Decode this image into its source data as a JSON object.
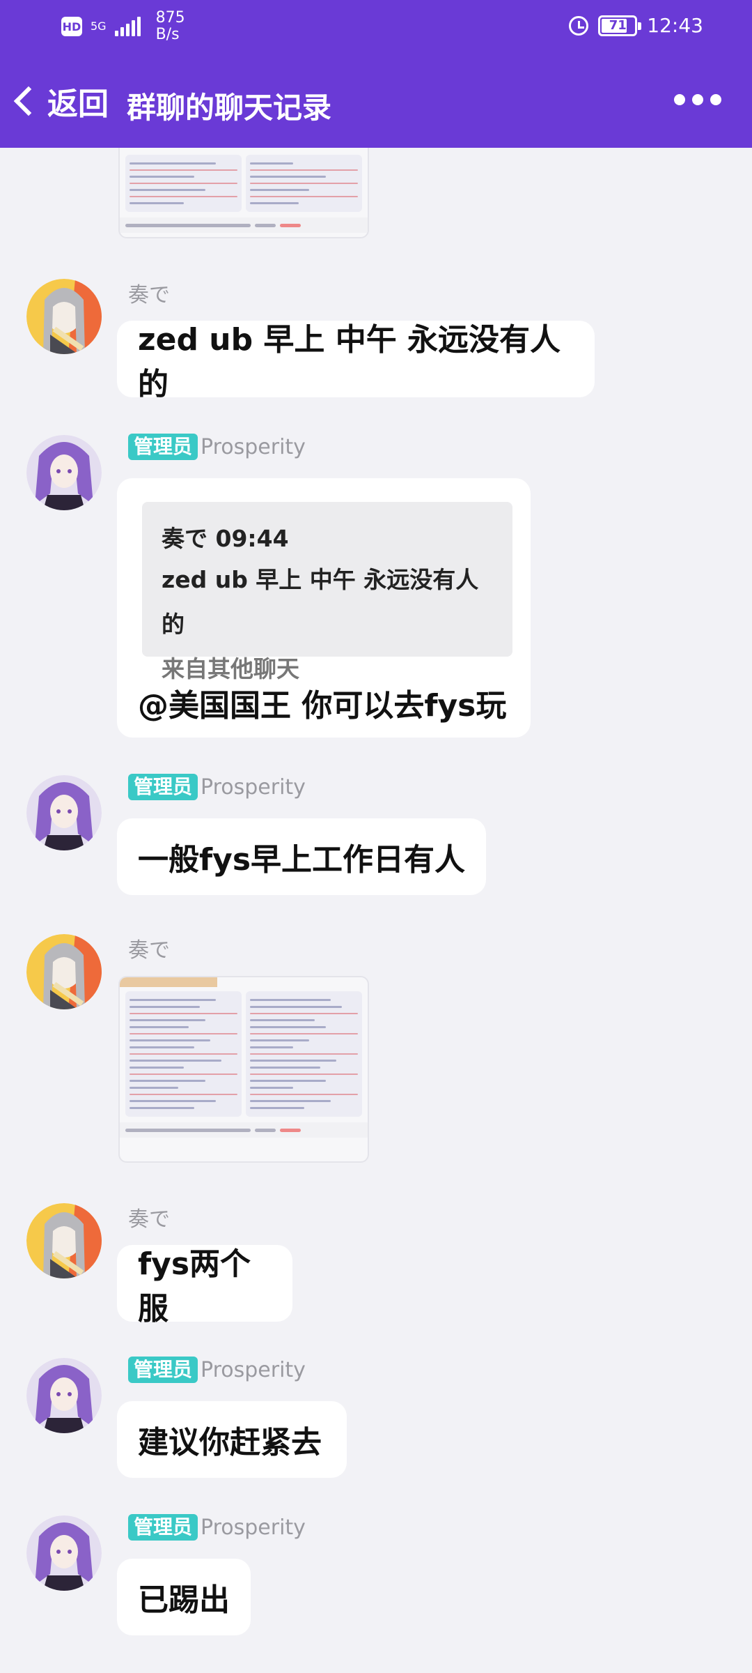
{
  "status_bar": {
    "network": "5G",
    "hd": "HD",
    "speed_value": "875",
    "speed_unit": "B/s",
    "battery": "71",
    "time": "12:43"
  },
  "header": {
    "back_label": "返回",
    "title": "群聊的聊天记录"
  },
  "messages": [
    {
      "type": "image",
      "sender": "奏で"
    },
    {
      "sender": "奏で",
      "text": "zed ub 早上 中午 永远没有人的"
    },
    {
      "sender": "Prosperity",
      "badge": "管理员",
      "quote": {
        "author_time": "奏で 09:44",
        "text": "zed ub 早上 中午 永远没有人的",
        "from": "来自其他聊天"
      },
      "text": "@美国国王 你可以去fys玩"
    },
    {
      "sender": "Prosperity",
      "badge": "管理员",
      "text": "一般fys早上工作日有人"
    },
    {
      "sender": "奏で",
      "type": "image"
    },
    {
      "sender": "奏で",
      "text": "fys两个服"
    },
    {
      "sender": "Prosperity",
      "badge": "管理员",
      "text": "建议你赶紧去"
    },
    {
      "sender": "Prosperity",
      "badge": "管理员",
      "text": "已踢出"
    }
  ]
}
